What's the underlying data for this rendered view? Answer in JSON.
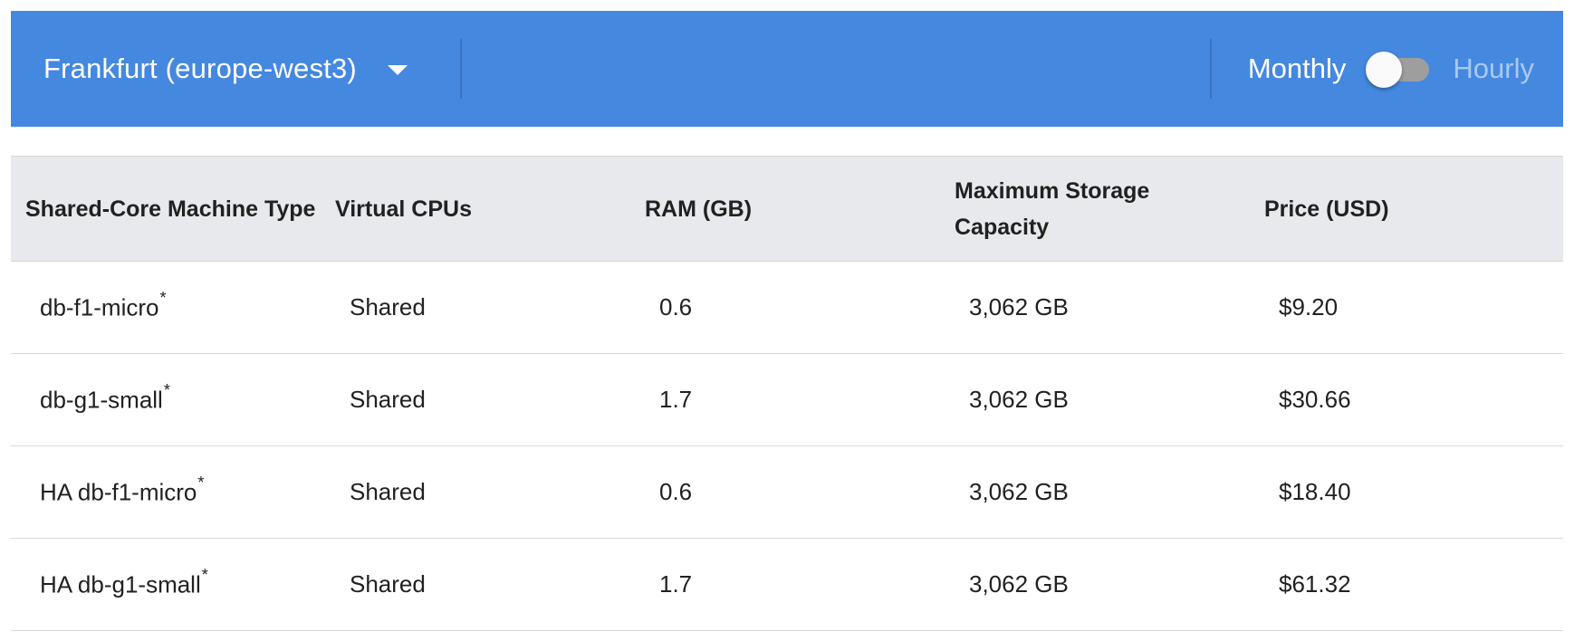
{
  "header": {
    "region": "Frankfurt (europe-west3)",
    "toggle_left_label": "Monthly",
    "toggle_right_label": "Hourly",
    "toggle_state": "Monthly",
    "colors": {
      "bar_background": "#4488e0",
      "inactive_label": "#a9c8f2"
    }
  },
  "table": {
    "columns": [
      "Shared-Core Machine Type",
      "Virtual CPUs",
      "RAM (GB)",
      "Maximum Storage Capacity",
      "Price (USD)"
    ],
    "rows": [
      {
        "type": "db-f1-micro",
        "mark": "*",
        "cpus": "Shared",
        "ram": "0.6",
        "storage": "3,062 GB",
        "price": "$9.20"
      },
      {
        "type": "db-g1-small",
        "mark": "*",
        "cpus": "Shared",
        "ram": "1.7",
        "storage": "3,062 GB",
        "price": "$30.66"
      },
      {
        "type": "HA db-f1-micro",
        "mark": "*",
        "cpus": "Shared",
        "ram": "0.6",
        "storage": "3,062 GB",
        "price": "$18.40"
      },
      {
        "type": "HA db-g1-small",
        "mark": "*",
        "cpus": "Shared",
        "ram": "1.7",
        "storage": "3,062 GB",
        "price": "$61.32"
      }
    ]
  }
}
